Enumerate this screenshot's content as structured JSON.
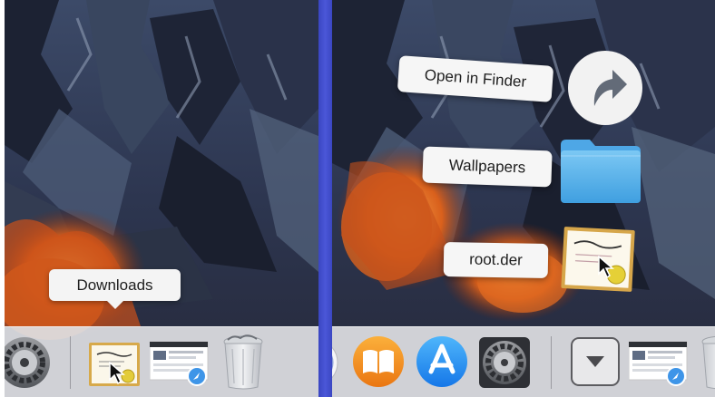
{
  "left_panel": {
    "tooltip": "Downloads"
  },
  "right_panel": {
    "stack_items": [
      {
        "label": "Open in Finder",
        "icon": "arrow-circle-icon"
      },
      {
        "label": "Wallpapers",
        "icon": "folder-icon"
      },
      {
        "label": "root.der",
        "icon": "certificate-icon"
      }
    ]
  },
  "icons": {
    "system_preferences": "gear-icon",
    "downloads_stack": "certificate-icon",
    "screenshot": "screenshot-thumbnail-icon",
    "trash": "trash-icon",
    "ibooks": "book-icon",
    "app_store": "app-store-icon",
    "stack_expand": "chevron-down-icon"
  },
  "colors": {
    "divider": "#4b57d8",
    "dock_background": "#dedee2",
    "folder": "#5fb4ea",
    "app_store_blue": "#1f8ef3",
    "ibooks_orange": "#f08a12"
  }
}
